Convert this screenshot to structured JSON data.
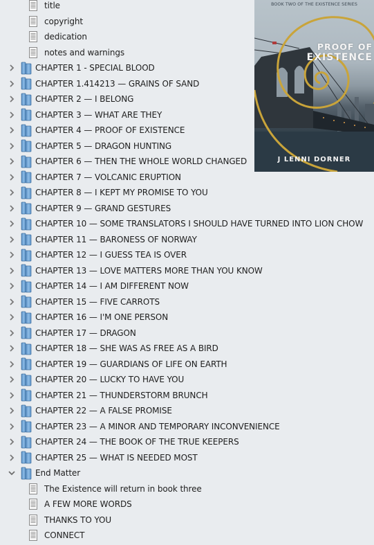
{
  "tree": {
    "front_matter": [
      {
        "label": "title",
        "icon": "document-icon"
      },
      {
        "label": "copyright",
        "icon": "document-icon"
      },
      {
        "label": "dedication",
        "icon": "document-icon"
      },
      {
        "label": "notes and warnings",
        "icon": "document-icon"
      }
    ],
    "chapters": [
      {
        "label": "CHAPTER 1 - SPECIAL BLOOD",
        "expanded": false
      },
      {
        "label": "CHAPTER 1.414213 —  GRAINS OF SAND",
        "expanded": false
      },
      {
        "label": "CHAPTER 2 — I BELONG",
        "expanded": false
      },
      {
        "label": "CHAPTER 3  — WHAT ARE THEY",
        "expanded": false
      },
      {
        "label": "CHAPTER 4 — PROOF OF EXISTENCE",
        "expanded": false
      },
      {
        "label": "CHAPTER 5 — DRAGON HUNTING",
        "expanded": false
      },
      {
        "label": "CHAPTER 6 —  THEN THE WHOLE WORLD CHANGED",
        "expanded": false
      },
      {
        "label": "CHAPTER 7 — VOLCANIC ERUPTION",
        "expanded": false
      },
      {
        "label": "CHAPTER 8 — I KEPT MY PROMISE TO YOU",
        "expanded": false
      },
      {
        "label": "CHAPTER 9 — GRAND GESTURES",
        "expanded": false
      },
      {
        "label": "CHAPTER 10 — SOME TRANSLATORS I SHOULD HAVE TURNED INTO LION CHOW",
        "expanded": false
      },
      {
        "label": "CHAPTER 11 — BARONESS OF NORWAY",
        "expanded": false
      },
      {
        "label": "CHAPTER 12 — I GUESS TEA IS OVER",
        "expanded": false
      },
      {
        "label": "CHAPTER 13 — LOVE MATTERS MORE THAN YOU KNOW",
        "expanded": false
      },
      {
        "label": "CHAPTER 14 — I AM DIFFERENT NOW",
        "expanded": false
      },
      {
        "label": "CHAPTER 15 — FIVE CARROTS",
        "expanded": false
      },
      {
        "label": "CHAPTER 16 — I'M ONE PERSON",
        "expanded": false
      },
      {
        "label": "CHAPTER 17 — DRAGON",
        "expanded": false
      },
      {
        "label": "CHAPTER 18 — SHE WAS AS FREE AS A BIRD",
        "expanded": false
      },
      {
        "label": "CHAPTER 19 — GUARDIANS OF LIFE ON EARTH",
        "expanded": false
      },
      {
        "label": "CHAPTER 20 — LUCKY TO HAVE YOU",
        "expanded": false
      },
      {
        "label": "CHAPTER 21 — THUNDERSTORM BRUNCH",
        "expanded": false
      },
      {
        "label": "CHAPTER 22 — A FALSE PROMISE",
        "expanded": false
      },
      {
        "label": "CHAPTER 23 — A MINOR AND TEMPORARY INCONVENIENCE",
        "expanded": false
      },
      {
        "label": "CHAPTER 24 — THE BOOK OF THE TRUE KEEPERS",
        "expanded": false
      },
      {
        "label": "CHAPTER 25 — WHAT IS NEEDED MOST",
        "expanded": false
      }
    ],
    "end_matter": {
      "label": "End Matter",
      "expanded": true,
      "children": [
        {
          "label": "The Existence will return in book three",
          "icon": "document-icon"
        },
        {
          "label": "A FEW MORE WORDS",
          "icon": "document-icon"
        },
        {
          "label": "THANKS TO YOU",
          "icon": "document-icon"
        },
        {
          "label": "CONNECT",
          "icon": "document-icon"
        }
      ]
    }
  },
  "cover": {
    "series": "BOOK TWO OF THE EXISTENCE SERIES",
    "title_line1": "PROOF OF",
    "title_line2": "EXISTENCE",
    "author": "J LENNI DORNER",
    "accent_color": "#c9a43a"
  },
  "colors": {
    "background": "#e9ecef",
    "folder_blue": "#6fa0cf",
    "chevron": "#7a7a7a",
    "text": "#1e1e1e"
  }
}
